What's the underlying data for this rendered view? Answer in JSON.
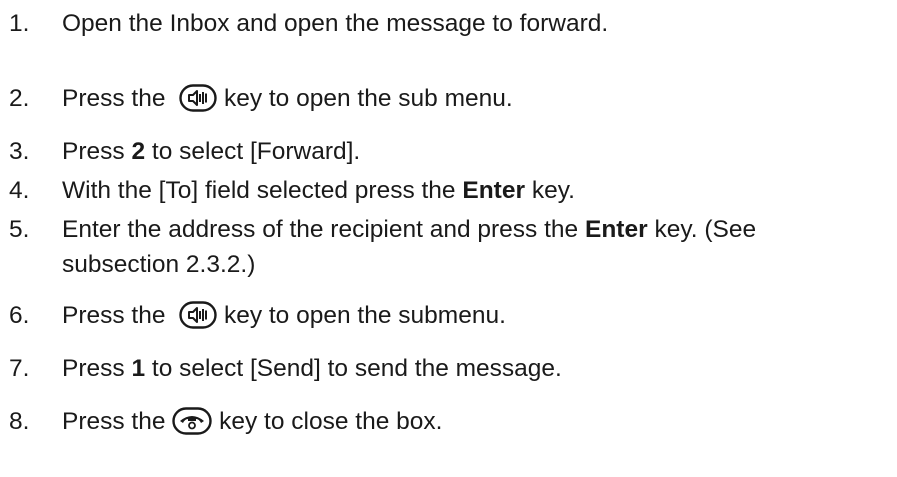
{
  "steps": [
    {
      "num": "1.",
      "text": "Open the Inbox and open the message to forward."
    },
    {
      "num": "2.",
      "pre": "Press the",
      "icon": "speaker-key-icon",
      "post": "key to open the sub menu."
    },
    {
      "num": "3.",
      "pre": "Press",
      "bold": "2",
      "post": "to select [Forward]."
    },
    {
      "num": "4.",
      "pre": "With the [To] field selected press the",
      "bold": "Enter",
      "post": "key."
    },
    {
      "num": "5.",
      "pre": "Enter the address of the recipient and press the",
      "bold": "Enter",
      "post": "key. (See",
      "line2": "subsection 2.3.2.)"
    },
    {
      "num": "6.",
      "pre": "Press the",
      "icon": "speaker-key-icon",
      "post": "key to open the submenu."
    },
    {
      "num": "7.",
      "pre": "Press",
      "bold": "1",
      "post": "to select [Send] to send the message."
    },
    {
      "num": "8.",
      "pre": "Press the",
      "icon": "end-call-key-icon",
      "post": "key to close the box."
    }
  ]
}
